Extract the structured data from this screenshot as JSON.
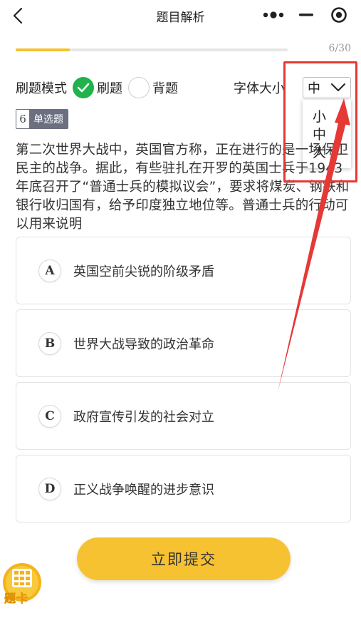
{
  "nav": {
    "title": "题目解析",
    "icons": [
      "back-arrow-icon",
      "more-dots-icon",
      "minimize-icon",
      "close-target-icon"
    ]
  },
  "progress": {
    "current": 6,
    "total": 30,
    "text": "6/30",
    "fraction": 0.2,
    "color": "#f5c12e"
  },
  "mode": {
    "label": "刷题模式",
    "options": [
      {
        "label": "刷题",
        "checked": true
      },
      {
        "label": "背题",
        "checked": false
      }
    ],
    "checked_color": "#21b24b"
  },
  "font_size": {
    "label": "字体大小",
    "selected": "中",
    "options": [
      "小",
      "中",
      "大"
    ]
  },
  "question": {
    "number": "6",
    "type": "单选题",
    "text": "第二次世界大战中，英国官方称，正在进行的是一场保卫民主的战争。据此，有些驻扎在开罗的英国士兵于1943年底召开了“普通士兵的模拟议会”，要求将煤炭、钢铁和银行收归国有，给予印度独立地位等。普通士兵的行动可以用来说明",
    "options": [
      {
        "letter": "A",
        "text": "英国空前尖锐的阶级矛盾"
      },
      {
        "letter": "B",
        "text": "世界大战导致的政治革命"
      },
      {
        "letter": "C",
        "text": "政府宣传引发的社会对立"
      },
      {
        "letter": "D",
        "text": "正义战争唤醒的进步意识"
      }
    ]
  },
  "submit": {
    "label": "立即提交",
    "color": "#f7c232"
  },
  "answer_card": {
    "label": "题卡",
    "icon": "grid-card-icon"
  },
  "annotation": {
    "color": "#e53935"
  }
}
